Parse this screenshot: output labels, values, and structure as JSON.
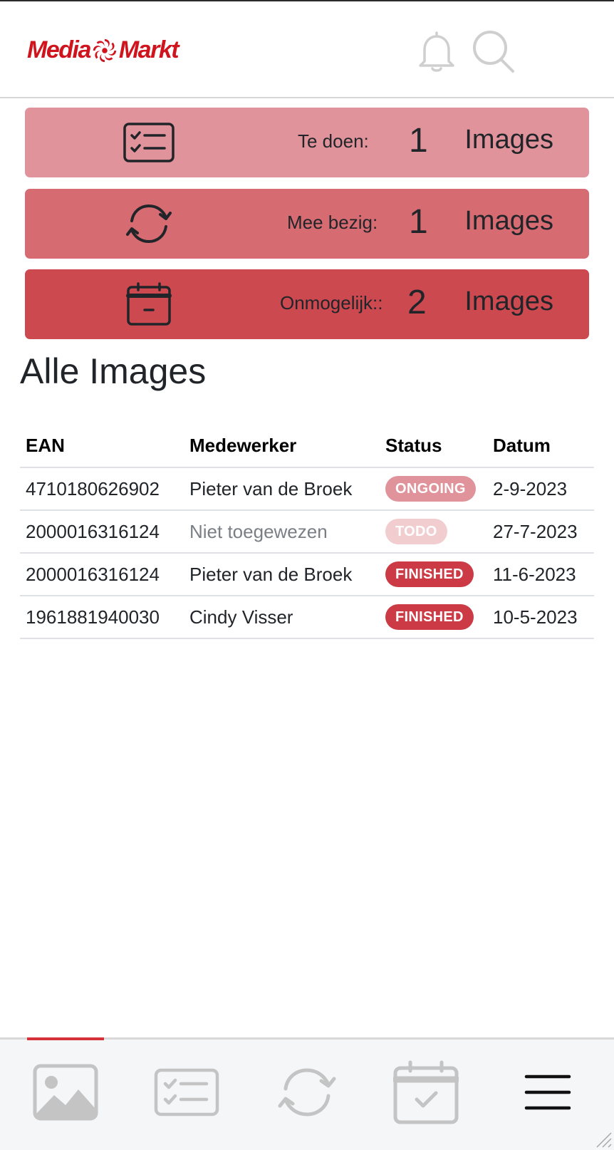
{
  "header": {
    "logo_text_left": "Media",
    "logo_text_right": "Markt",
    "icons": [
      "bell-icon",
      "search-icon"
    ]
  },
  "stats": [
    {
      "id": "todo",
      "label": "Te doen:",
      "count": "1",
      "unit": "Images",
      "icon": "checklist-icon",
      "color": "#e0939a"
    },
    {
      "id": "ongoing",
      "label": "Mee bezig:",
      "count": "1",
      "unit": "Images",
      "icon": "sync-icon",
      "color": "#d66b72"
    },
    {
      "id": "impossible",
      "label": "Onmogelijk::",
      "count": "2",
      "unit": "Images",
      "icon": "calendar-minus-icon",
      "color": "#cc4950"
    }
  ],
  "section_title": "Alle Images",
  "table": {
    "headers": [
      "EAN",
      "Medewerker",
      "Status",
      "Datum"
    ],
    "rows": [
      {
        "ean": "4710180626902",
        "employee": "Pieter van de Broek",
        "status": "ONGOING",
        "date": "2-9-2023"
      },
      {
        "ean": "2000016316124",
        "employee": "Niet toegewezen",
        "status": "TODO",
        "date": "27-7-2023"
      },
      {
        "ean": "2000016316124",
        "employee": "Pieter van de Broek",
        "status": "FINISHED",
        "date": "11-6-2023"
      },
      {
        "ean": "1961881940030",
        "employee": "Cindy Visser",
        "status": "FINISHED",
        "date": "10-5-2023"
      }
    ]
  },
  "bottom_nav": {
    "items": [
      "image-icon",
      "checklist-icon",
      "sync-icon",
      "calendar-check-icon",
      "menu-icon"
    ],
    "active": "image-icon"
  },
  "colors": {
    "brand": "#d0141e",
    "todo": "#e0939a",
    "ongoing": "#d66b72",
    "impossible": "#cc4950",
    "finished": "#cc3a45",
    "todo_badge": "#f2cdd0"
  }
}
